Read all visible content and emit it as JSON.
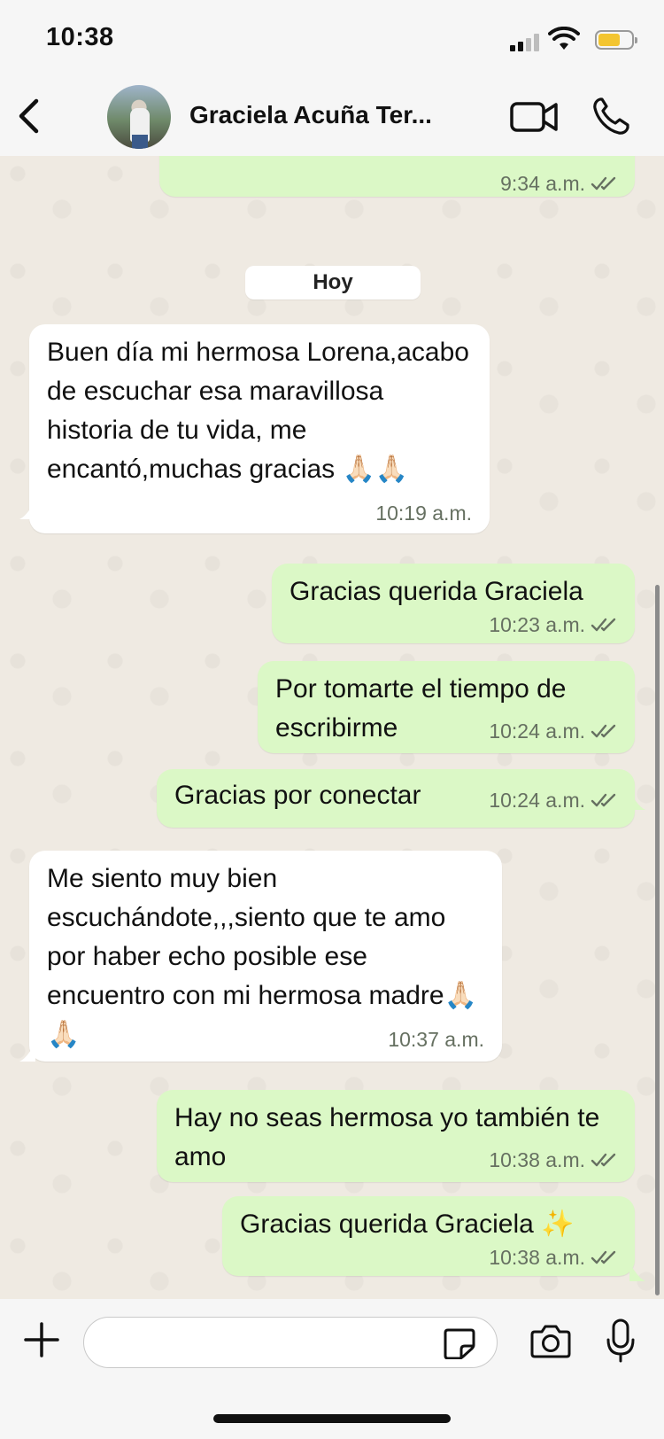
{
  "status_bar": {
    "time": "10:38"
  },
  "header": {
    "contact_name": "Graciela Acuña Ter..."
  },
  "chat": {
    "date_separator": "Hoy",
    "prev_message_time": "9:34 a.m.",
    "messages": [
      {
        "direction": "in",
        "text": "Buen día mi hermosa Lorena,acabo de escuchar esa maravillosa historia de tu vida, me encantó,muchas gracias 🙏🏻🙏🏻",
        "time": "10:19 a.m."
      },
      {
        "direction": "out",
        "text": "Gracias querida Graciela",
        "time": "10:23 a.m.",
        "status": "read"
      },
      {
        "direction": "out",
        "text": "Por tomarte el tiempo de escribirme",
        "time": "10:24 a.m.",
        "status": "read"
      },
      {
        "direction": "out",
        "text": "Gracias por conectar",
        "time": "10:24 a.m.",
        "status": "read"
      },
      {
        "direction": "in",
        "text": "Me siento muy bien escuchándote,,,siento que te amo por haber echo posible ese encuentro con mi hermosa madre🙏🏻🙏🏻",
        "time": "10:37 a.m."
      },
      {
        "direction": "out",
        "text": "Hay no seas hermosa yo también te amo",
        "time": "10:38 a.m.",
        "status": "read"
      },
      {
        "direction": "out",
        "text": "Gracias querida Graciela ✨",
        "time": "10:38 a.m.",
        "status": "read"
      }
    ]
  },
  "composer": {
    "placeholder": ""
  },
  "colors": {
    "incoming_bubble": "#ffffff",
    "outgoing_bubble": "#dbf8c6",
    "chat_background": "#efeae2",
    "read_ticks": "#667061"
  },
  "icons": [
    "back-chevron-icon",
    "video-call-icon",
    "phone-icon",
    "plus-icon",
    "sticker-icon",
    "camera-icon",
    "microphone-icon"
  ]
}
